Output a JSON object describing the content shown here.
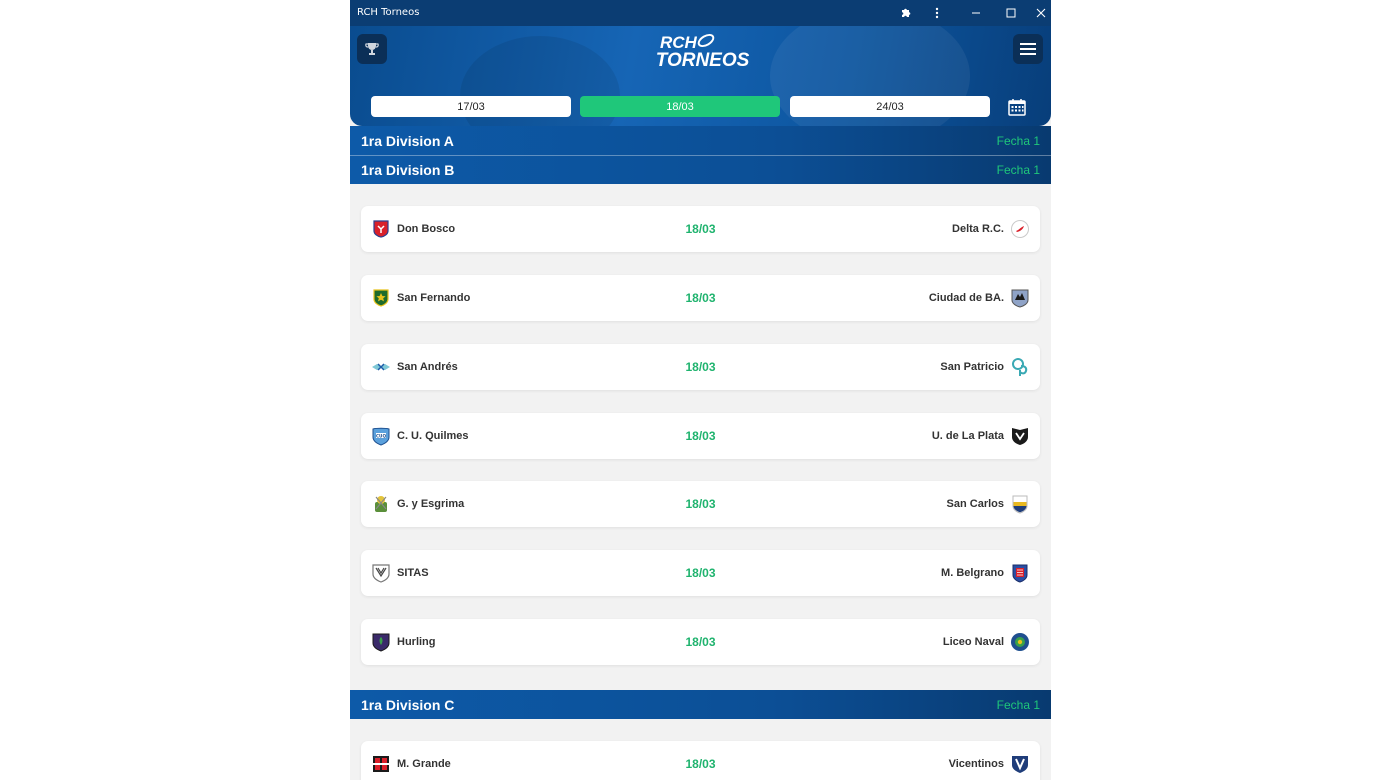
{
  "window": {
    "title": "RCH Torneos"
  },
  "header": {
    "logo_line1": "RCH",
    "logo_line2": "TORNEOS",
    "dates": [
      {
        "label": "17/03",
        "active": false
      },
      {
        "label": "18/03",
        "active": true
      },
      {
        "label": "24/03",
        "active": false
      }
    ]
  },
  "divisions": [
    {
      "name": "1ra Division A",
      "fecha": "Fecha 1",
      "matches": []
    },
    {
      "name": "1ra Division B",
      "fecha": "Fecha 1",
      "matches": [
        {
          "home": "Don Bosco",
          "date": "18/03",
          "away": "Delta R.C."
        },
        {
          "home": "San Fernando",
          "date": "18/03",
          "away": "Ciudad de BA."
        },
        {
          "home": "San Andrés",
          "date": "18/03",
          "away": "San Patricio"
        },
        {
          "home": "C. U. Quilmes",
          "date": "18/03",
          "away": "U. de La Plata"
        },
        {
          "home": "G. y Esgrima",
          "date": "18/03",
          "away": "San Carlos"
        },
        {
          "home": "SITAS",
          "date": "18/03",
          "away": "M. Belgrano"
        },
        {
          "home": "Hurling",
          "date": "18/03",
          "away": "Liceo Naval"
        }
      ]
    },
    {
      "name": "1ra Division C",
      "fecha": "Fecha 1",
      "matches": [
        {
          "home": "M. Grande",
          "date": "18/03",
          "away": "Vicentinos"
        }
      ]
    }
  ],
  "colors": {
    "brand": "#0b3d73",
    "accent": "#1fc77a"
  },
  "icons": [
    "puzzle-icon",
    "more-vertical-icon",
    "minimize-icon",
    "maximize-icon",
    "close-icon",
    "trophy-icon",
    "hamburger-menu-icon",
    "calendar-icon"
  ]
}
